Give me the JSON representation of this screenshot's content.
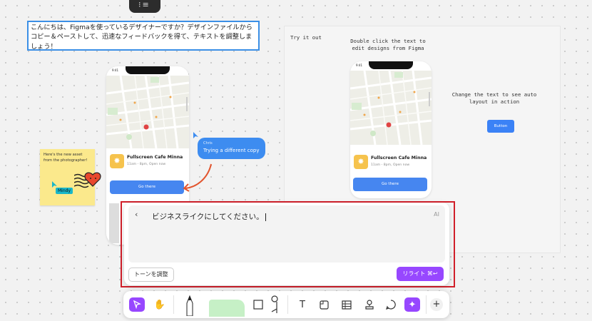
{
  "intro_text": "こんにちは、Figmaを使っているデザイナーですか？デザインファイルからコピー＆ペーストして、迅速なフィードバックを得て、テキストを調整しましょう！",
  "phones": [
    {
      "time": "9:41",
      "cafe_name": "Fullscreen Cafe Minna",
      "cafe_hours": "11am - 8pm, Open now",
      "cta_label": "Go there"
    },
    {
      "time": "9:41",
      "cafe_name": "Fullscreen Cafe Minna",
      "cafe_hours": "11am - 8pm, Open now",
      "cta_label": "Go there"
    }
  ],
  "chat": {
    "name": "Chris",
    "message": "Trying a different copy"
  },
  "sticky": {
    "text": "Here's the new asset from the photographer!",
    "cursor_user": "Mindy"
  },
  "annotations": {
    "try_it_out": "Try it out",
    "double_click": "Double click the text to edit designs from Figma",
    "change_text": "Change the text to see auto layout in action"
  },
  "auto_layout_button": "Button",
  "ai_panel": {
    "prompt": "ビジネスライクにしてください。",
    "badge": "AI",
    "tone_button": "トーンを調整",
    "rewrite_button": "リライト ⌘↩"
  },
  "toolbar": {
    "tools": [
      "move-tool",
      "hand-tool",
      "pen-tool",
      "marker-tool",
      "shape-tool",
      "connector-tool",
      "text-tool",
      "section-tool",
      "table-tool",
      "stamp-tool",
      "comment-tool",
      "ai-tool",
      "more-tool"
    ]
  },
  "colors": {
    "accent": "#9747ff",
    "selection": "#3b8fe6",
    "highlight": "#d11f2a",
    "brand_blue": "#4686f0"
  }
}
